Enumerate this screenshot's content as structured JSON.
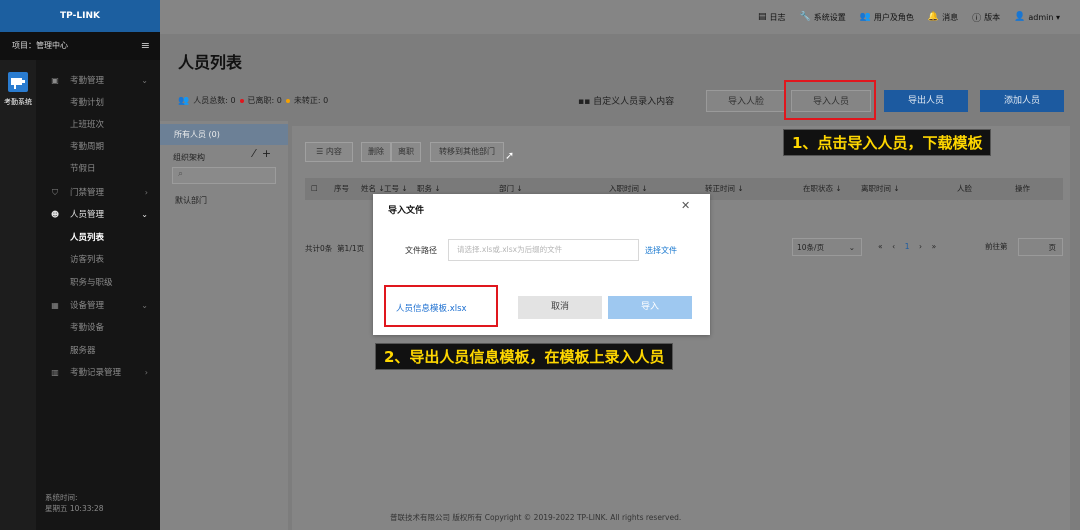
{
  "sidebar": {
    "brand": "TP-LINK",
    "project": "项目：管理中心",
    "app_label": "考勤系统",
    "items": [
      {
        "label": "考勤管理",
        "icon": "briefcase-icon",
        "type": "group"
      },
      {
        "label": "考勤计划",
        "type": "sub"
      },
      {
        "label": "上班班次",
        "type": "sub"
      },
      {
        "label": "考勤周期",
        "type": "sub"
      },
      {
        "label": "节假日",
        "type": "sub"
      },
      {
        "label": "门禁管理",
        "icon": "shield-icon",
        "type": "group"
      },
      {
        "label": "人员管理",
        "icon": "people-icon",
        "type": "group-open"
      },
      {
        "label": "人员列表",
        "type": "active"
      },
      {
        "label": "访客列表",
        "type": "sub"
      },
      {
        "label": "职务与职级",
        "type": "sub"
      },
      {
        "label": "设备管理",
        "icon": "device-icon",
        "type": "group"
      },
      {
        "label": "考勤设备",
        "type": "sub"
      },
      {
        "label": "服务器",
        "type": "sub"
      },
      {
        "label": "考勤记录管理",
        "icon": "bar-chart-icon",
        "type": "group"
      }
    ],
    "system_time_label": "系统时间:",
    "system_time_value": "星期五 10:33:28"
  },
  "header": {
    "links": [
      {
        "label": "日志",
        "icon": "log-icon"
      },
      {
        "label": "系统设置",
        "icon": "wrench-icon"
      },
      {
        "label": "用户及角色",
        "icon": "users-icon"
      },
      {
        "label": "消息",
        "icon": "bell-icon"
      },
      {
        "label": "版本",
        "icon": "info-icon"
      },
      {
        "label": "admin ▾",
        "icon": "user-icon"
      }
    ]
  },
  "page": {
    "title": "人员列表",
    "stats": {
      "total_label": "人员总数: 0",
      "resigned_label": "已离职: 0",
      "unregular_label": "未转正: 0"
    },
    "custom_entry": "自定义人员录入内容",
    "buttons": {
      "import_face": "导入人脸",
      "import_people": "导入人员",
      "export_people": "导出人员",
      "add_people": "添加人员"
    }
  },
  "org": {
    "all_people": "所有人员 (0)",
    "title": "组织架构",
    "default_dept": "默认部门"
  },
  "toolbar": {
    "content": "☰ 内容",
    "delete": "删除",
    "resign": "离职",
    "move": "转移到其他部门"
  },
  "table": {
    "columns": [
      "序号",
      "姓名 ↓",
      "工号 ↓",
      "职务 ↓",
      "部门 ↓",
      "入职时间 ↓",
      "转正时间 ↓",
      "在职状态 ↓",
      "离职时间 ↓",
      "人脸",
      "操作"
    ]
  },
  "pagination": {
    "total": "共计0条",
    "pages": "第1/1页",
    "page_size": "10条/页",
    "current": "1",
    "goto_label": "前往第",
    "page_unit": "页"
  },
  "footer": "普联技术有限公司 版权所有 Copyright © 2019-2022 TP-LINK. All rights reserved.",
  "dialog": {
    "title": "导入文件",
    "path_label": "文件路径",
    "path_placeholder": "请选择.xls或.xlsx为后缀的文件",
    "choose": "选择文件",
    "template_link": "人员信息模板.xlsx",
    "cancel": "取消",
    "import": "导入"
  },
  "annotations": {
    "step1": "1、点击导入人员，下载模板",
    "step2": "2、导出人员信息模板，在模板上录入人员"
  },
  "colors": {
    "brand": "#1c5fa0",
    "primary": "#1c5aa0",
    "highlight": "#e0161d",
    "callout_text": "#ffd700",
    "link": "#1c6fd0"
  }
}
